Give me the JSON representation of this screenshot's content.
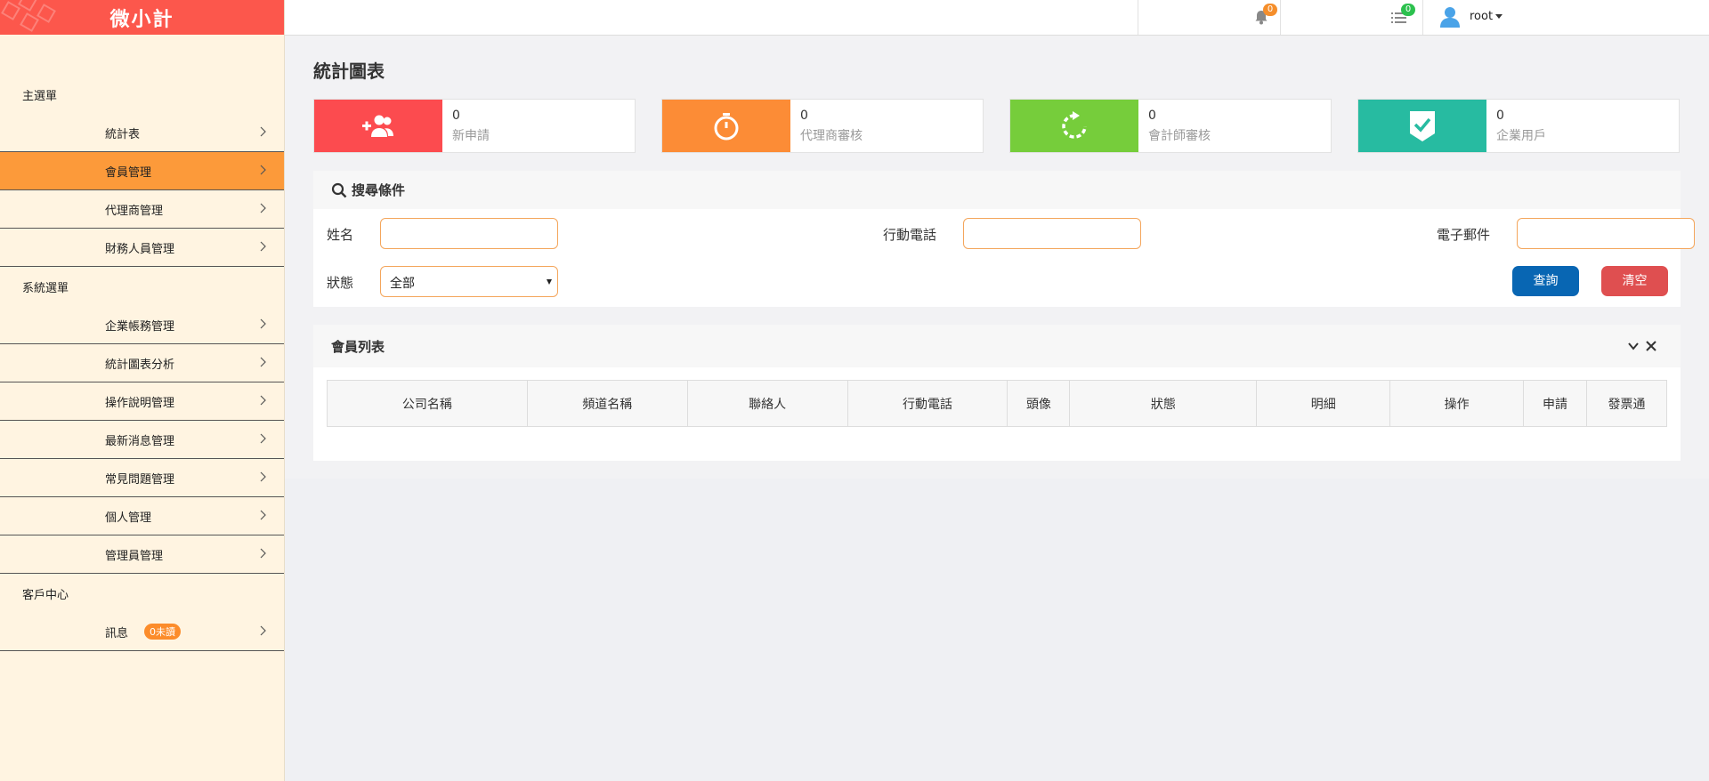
{
  "app": {
    "logo_text": "微小計"
  },
  "sidebar": {
    "sections": [
      {
        "title": "主選單",
        "items": [
          {
            "label": "統計表"
          },
          {
            "label": "會員管理",
            "active": true
          },
          {
            "label": "代理商管理"
          },
          {
            "label": "財務人員管理"
          }
        ]
      },
      {
        "title": "系統選單",
        "items": [
          {
            "label": "企業帳務管理"
          },
          {
            "label": "統計圖表分析"
          },
          {
            "label": "操作說明管理"
          },
          {
            "label": "最新消息管理"
          },
          {
            "label": "常見問題管理"
          },
          {
            "label": "個人管理"
          },
          {
            "label": "管理員管理"
          }
        ]
      },
      {
        "title": "客戶中心",
        "items": [
          {
            "label": "訊息",
            "badge": "0未讀"
          }
        ]
      }
    ]
  },
  "header": {
    "notifications_count": "0",
    "tasks_count": "0",
    "user_name": "root"
  },
  "page": {
    "title": "統計圖表"
  },
  "stats": [
    {
      "value": "0",
      "label": "新申請",
      "color": "#fc4b4f",
      "icon": "add-user-icon"
    },
    {
      "value": "0",
      "label": "代理商審核",
      "color": "#fc8c36",
      "icon": "timer-icon"
    },
    {
      "value": "0",
      "label": "會計師審核",
      "color": "#76cd3b",
      "icon": "refresh-icon"
    },
    {
      "value": "0",
      "label": "企業用戶",
      "color": "#27bba1",
      "icon": "check-shield-icon"
    }
  ],
  "search": {
    "title": "搜尋條件",
    "name_label": "姓名",
    "name_value": "",
    "phone_label": "行動電話",
    "phone_value": "",
    "email_label": "電子郵件",
    "email_value": "",
    "status_label": "狀態",
    "status_value": "全部",
    "query_label": "查詢",
    "clear_label": "清空"
  },
  "member_list": {
    "title": "會員列表",
    "columns": [
      "公司名稱",
      "頻道名稱",
      "聯絡人",
      "行動電話",
      "頭像",
      "狀態",
      "明細",
      "操作",
      "申請",
      "發票通"
    ]
  }
}
